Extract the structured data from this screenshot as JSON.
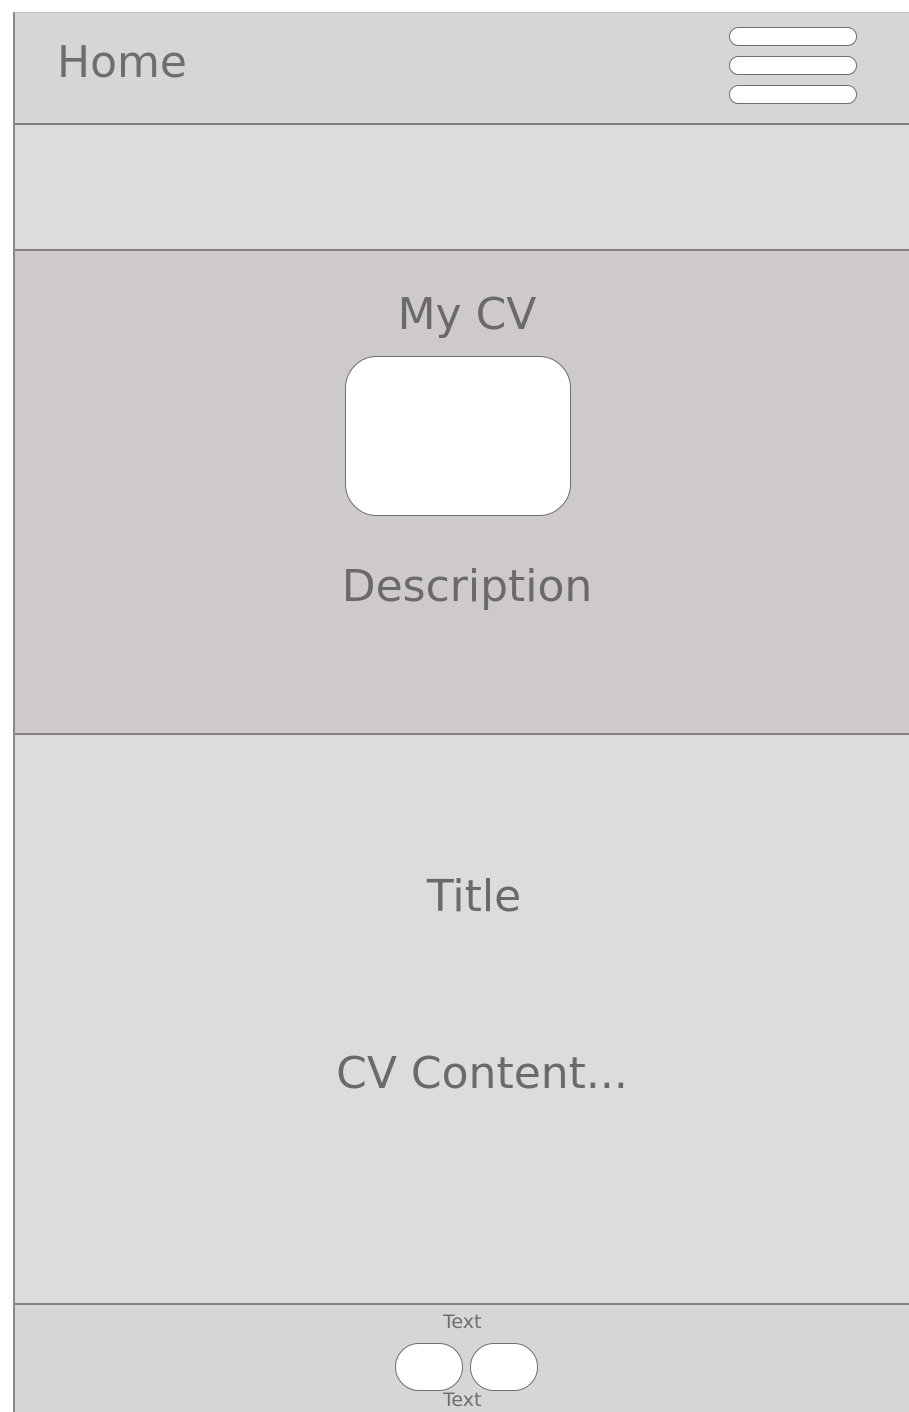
{
  "header": {
    "title": "Home",
    "menu_icon": "hamburger-menu-icon"
  },
  "hero": {
    "title": "My CV",
    "description": "Description"
  },
  "content": {
    "title": "Title",
    "body": "CV Content..."
  },
  "footer": {
    "label_top": "Text",
    "label_bottom": "Text"
  }
}
